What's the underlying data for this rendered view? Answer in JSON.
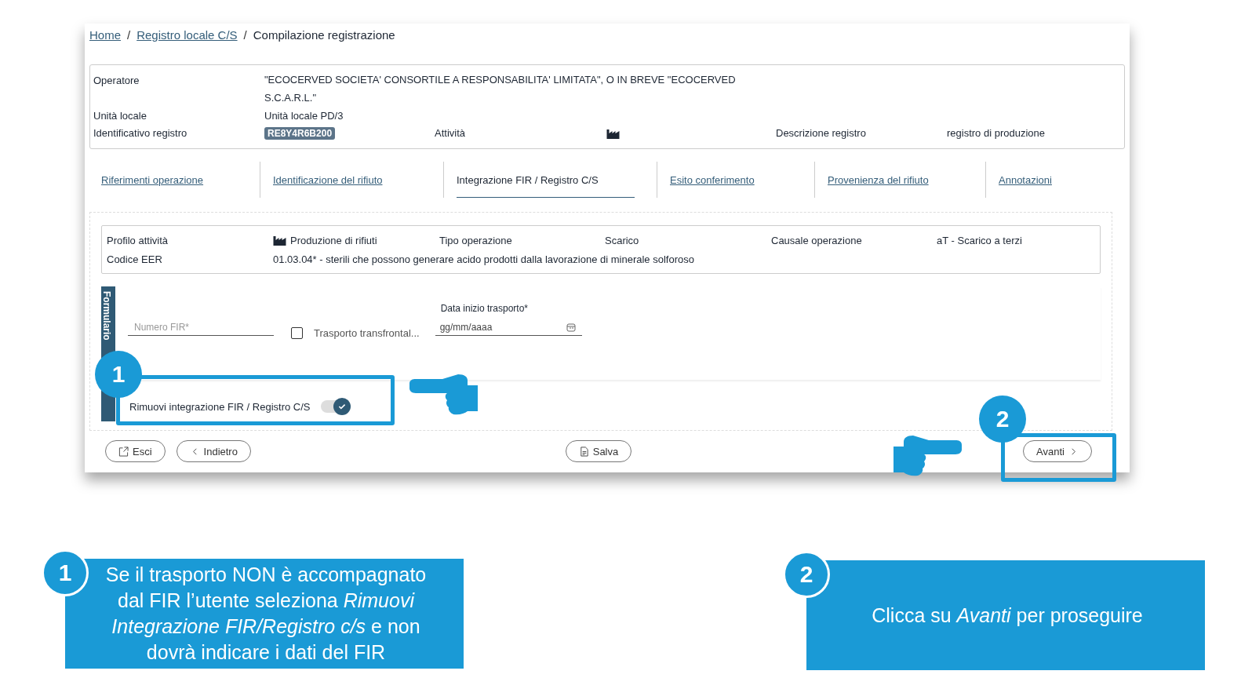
{
  "breadcrumb_separators": [
    "/",
    "/"
  ],
  "breadcrumb": [
    {
      "label": "Home",
      "link": true
    },
    {
      "label": "Registro locale C/S",
      "link": true
    },
    {
      "label": "Compilazione registrazione",
      "link": false
    }
  ],
  "info": {
    "operatore": {
      "label": "Operatore",
      "value": "\"ECOCERVED SOCIETA' CONSORTILE A RESPONSABILITA' LIMITATA\", O IN BREVE \"ECOCERVED S.C.A.R.L.\""
    },
    "unita_locale": {
      "label": "Unità locale",
      "value": "Unità locale PD/3"
    },
    "identificativo": {
      "label": "Identificativo registro",
      "value": "RE8Y4R6B200"
    },
    "attivita": {
      "label": "Attività"
    },
    "descrizione": {
      "label": "Descrizione registro",
      "value": "registro di produzione"
    }
  },
  "tabs": [
    {
      "label": "Riferimenti operazione",
      "selected": false
    },
    {
      "label": "Identificazione del rifiuto",
      "selected": false
    },
    {
      "label": "Integrazione FIR / Registro C/S",
      "selected": true
    },
    {
      "label": "Esito conferimento",
      "selected": false
    },
    {
      "label": "Provenienza del rifiuto",
      "selected": false
    },
    {
      "label": "Annotazioni",
      "selected": false
    }
  ],
  "summary": {
    "profilo": {
      "label": "Profilo attività",
      "value": "Produzione di rifiuti"
    },
    "tipo_operazione": {
      "label": "Tipo operazione",
      "value": "Scarico"
    },
    "causale": {
      "label": "Causale operazione",
      "value": "aT - Scarico a terzi"
    },
    "codice_eer": {
      "label": "Codice EER",
      "value": "01.03.04* - sterili che possono generare acido prodotti dalla lavorazione di minerale solforoso"
    }
  },
  "form": {
    "section_label": "Formulario",
    "numero_fir": {
      "placeholder": "Numero FIR*"
    },
    "transfrontaliero": {
      "label": "Trasporto transfrontal...",
      "checked": false
    },
    "data_inizio": {
      "label": "Data inizio trasporto*",
      "placeholder": "gg/mm/aaaa"
    },
    "rimuovi": {
      "label": "Rimuovi integrazione FIR / Registro C/S",
      "on": true
    }
  },
  "buttons": [
    {
      "label": "Esci",
      "kind": "exit"
    },
    {
      "label": "Indietro",
      "kind": "back"
    },
    {
      "label": "Salva",
      "kind": "save"
    },
    {
      "label": "Avanti",
      "kind": "next"
    }
  ],
  "markers": [
    {
      "number": "1"
    },
    {
      "number": "2"
    }
  ],
  "callouts": [
    {
      "number": "1",
      "text": "Se il trasporto NON è accompagnato dal FIR l’utente seleziona *Rimuovi Integrazione FIR/Registro c/s* e non dovrà indicare i dati del FIR"
    },
    {
      "number": "2",
      "text": "Clicca su *Avanti* per proseguire"
    }
  ]
}
